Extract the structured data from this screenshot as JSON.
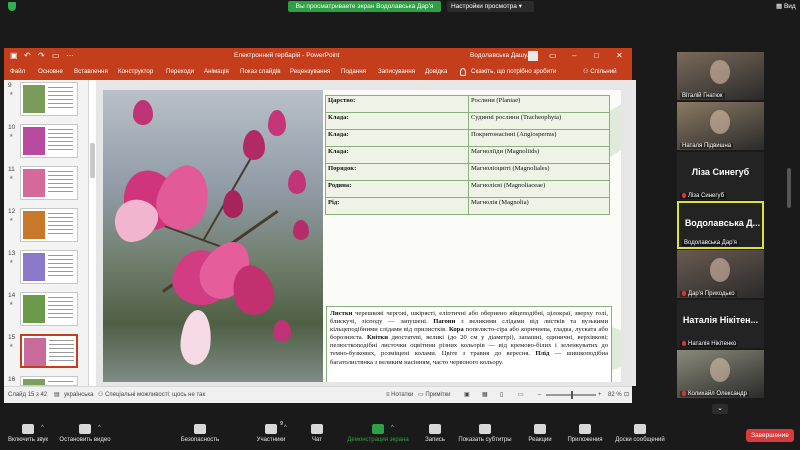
{
  "zoom": {
    "share_banner": "Вы просматриваете экран Водолавська Дар'я",
    "view_options": "Настройки просмотра",
    "view_label": "Вид"
  },
  "ppt": {
    "title": "Електронний гербарій - PowerPoint",
    "user": "Водолавська Дашуля",
    "ribbon_tabs": [
      "Файл",
      "Основне",
      "Вставлення",
      "Конструктор",
      "Переходи",
      "Анімація",
      "Показ слайдів",
      "Рецензування",
      "Подання",
      "Записування",
      "Довідка"
    ],
    "tell_me": "Скажіть, що потрібно зробити",
    "share": "Спільний доступ",
    "thumbnails": [
      {
        "num": "9",
        "photo_color": "#7a9c5a"
      },
      {
        "num": "10",
        "photo_color": "#b84aa0"
      },
      {
        "num": "11",
        "photo_color": "#d46a9a"
      },
      {
        "num": "12",
        "photo_color": "#c8782a"
      },
      {
        "num": "13",
        "photo_color": "#8a78c8"
      },
      {
        "num": "14",
        "photo_color": "#6a9a4a"
      },
      {
        "num": "15",
        "photo_color": "#c86a9a"
      },
      {
        "num": "16",
        "photo_color": "#7aa05a"
      }
    ],
    "active_thumb": "15",
    "table": [
      {
        "k": "Царство:",
        "v": "Рослини (Plantae)"
      },
      {
        "k": "Клада:",
        "v": "Судинні рослини (Tracheophyta)"
      },
      {
        "k": "Клада:",
        "v": "Покритонасінні (Angiosperms)"
      },
      {
        "k": "Клада:",
        "v": "Магноліїди (Magnoliids)"
      },
      {
        "k": "Порядок:",
        "v": "Магноліоцвіті (Magnoliales)"
      },
      {
        "k": "Родина:",
        "v": "Магнолієві (Magnoliaceae)"
      },
      {
        "k": "Рід:",
        "v": "Магнолія (Magnolia)"
      }
    ],
    "description": [
      {
        "b": "Листки",
        "t": " черешкові чергові, шкірясті, еліптичні або обернено яйцеподібні, цілокраї, зверху голі, блискучі, зісподу — запушені. "
      },
      {
        "b": "Пагони",
        "t": " з великими слідами від листків та вузькими кільцеподібними слідами від прилистків. "
      },
      {
        "b": "Кора",
        "t": " попелясто-сіра або коричнева, гладка, луската або борозниста. "
      },
      {
        "b": "Квітки",
        "t": " двостатеві, великі (до 20 см у діаметрі), запашні, одиничні, верхівкові; пелюсткоподібні листочки оцвітини різних кольорів — від кремово-білих і зеленкуватих до темно-бузкових, розміщені колами. Цвіте з травня до вересня. "
      },
      {
        "b": "Плід",
        "t": " — шишкоподібна багатолистянка з великим насінням, часто червоного кольору."
      }
    ],
    "status": {
      "slide": "Слайд 15 з 42",
      "lang": "українська",
      "accessibility": "Спеціальні можливості: щось не так",
      "notes": "Нотатки",
      "comments": "Примітки",
      "zoom": "82 %"
    }
  },
  "participants": [
    {
      "name": "Віталій Гнатюк",
      "type": "video",
      "color": "#7a6a5a"
    },
    {
      "name": "Наталя Підвишна",
      "type": "video",
      "color": "#8a7a62"
    },
    {
      "name": "Ліза Синегуб",
      "type": "name",
      "big": "Ліза Синегуб",
      "muted": true
    },
    {
      "name": "Водолавська Дар'я",
      "type": "name",
      "big": "Водолавська  Д...",
      "speaking": true
    },
    {
      "name": "Дар'я Приходько",
      "type": "video",
      "color": "#6a5a52",
      "muted": true
    },
    {
      "name": "Наталія Нікітенко",
      "type": "name",
      "big": "Наталія Нікітен...",
      "muted": true
    },
    {
      "name": "Колихайл Олександр",
      "type": "video",
      "color": "#8a8a7a",
      "muted": true
    }
  ],
  "toolbar": [
    {
      "label": "Включить звук",
      "caret": true
    },
    {
      "label": "Остановить видео",
      "caret": true
    },
    {
      "label": "Безопасность"
    },
    {
      "label": "Участники",
      "count": "9",
      "caret": true
    },
    {
      "label": "Чат"
    },
    {
      "label": "Демонстрация экрана",
      "green": true,
      "caret": true
    },
    {
      "label": "Запись"
    },
    {
      "label": "Показать субтитры"
    },
    {
      "label": "Реакции"
    },
    {
      "label": "Приложения"
    },
    {
      "label": "Доски сообщений"
    }
  ],
  "end_button": "Завершение"
}
